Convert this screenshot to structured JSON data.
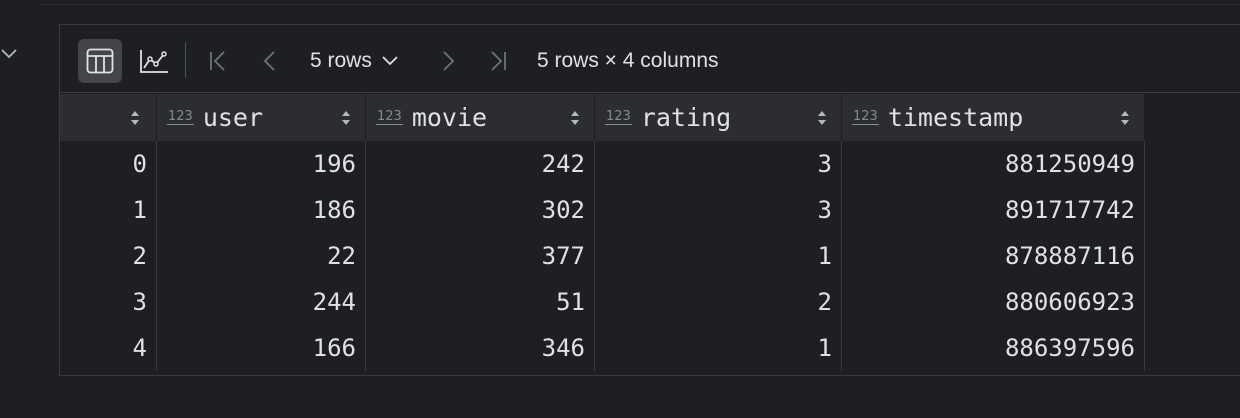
{
  "toolbar": {
    "rows_label": "5 rows",
    "summary": "5 rows × 4 columns"
  },
  "table": {
    "type_badge": "123",
    "columns": [
      "user",
      "movie",
      "rating",
      "timestamp"
    ],
    "rows": [
      {
        "index": "0",
        "user": "196",
        "movie": "242",
        "rating": "3",
        "timestamp": "881250949"
      },
      {
        "index": "1",
        "user": "186",
        "movie": "302",
        "rating": "3",
        "timestamp": "891717742"
      },
      {
        "index": "2",
        "user": "22",
        "movie": "377",
        "rating": "1",
        "timestamp": "878887116"
      },
      {
        "index": "3",
        "user": "244",
        "movie": "51",
        "rating": "2",
        "timestamp": "880606923"
      },
      {
        "index": "4",
        "user": "166",
        "movie": "346",
        "rating": "1",
        "timestamp": "886397596"
      }
    ]
  },
  "icons": {
    "table_view": "table-view-icon",
    "chart_view": "chart-view-icon",
    "first_page": "first-page-icon",
    "prev_page": "prev-page-icon",
    "next_page": "next-page-icon",
    "last_page": "last-page-icon",
    "sort": "sort-icon",
    "collapse": "chevron-down-icon"
  },
  "colors": {
    "background": "#1e1f22",
    "header_bg": "#2b2d30",
    "active_button_bg": "#43454a",
    "text": "#dfe1e5",
    "muted": "#868991"
  }
}
